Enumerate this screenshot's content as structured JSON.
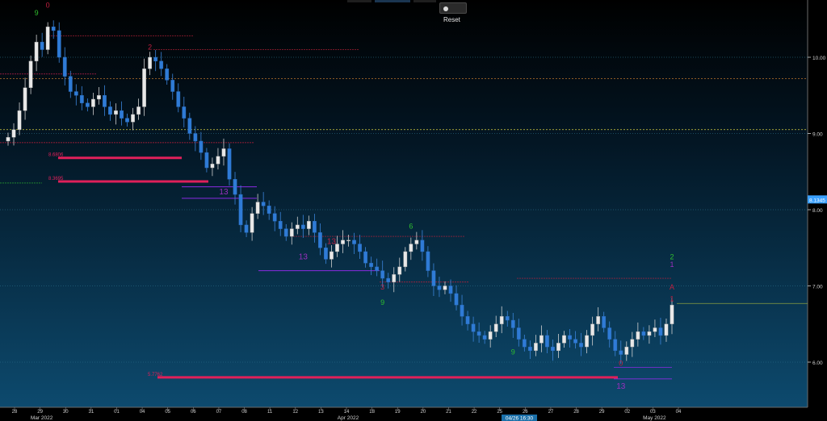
{
  "toolbar": {
    "reset_label": "Reset"
  },
  "colors": {
    "bg_top": "#000000",
    "bg_bottom": "#0d4a6e",
    "up_candle": "#e8e8e8",
    "down_candle": "#2f7bd6",
    "setup_buy": "#9b2fbf",
    "setup_sell": "#2fbf2f",
    "resistance": "#e0205a",
    "support_line": "#e0205a",
    "tdst_line": "#8a2be2",
    "current_price": "#3aa0ff"
  },
  "chart_data": {
    "type": "candlestick",
    "y_ticks": [
      "10.00",
      "9.00",
      "8.00",
      "7.00",
      "6.00"
    ],
    "current_price_label": "8.1345",
    "ylim": [
      5.05,
      10.6
    ],
    "x_ticks": [
      "28",
      "29",
      "30",
      "31",
      "01",
      "04",
      "05",
      "06",
      "07",
      "08",
      "11",
      "12",
      "13",
      "14",
      "18",
      "19",
      "20",
      "21",
      "22",
      "25",
      "26",
      "27",
      "28",
      "29",
      "02",
      "03",
      "04"
    ],
    "month_labels": [
      {
        "label": "Mar 2022",
        "index": 1
      },
      {
        "label": "Apr 2022",
        "index": 13
      },
      {
        "label": "May 2022",
        "index": 25
      }
    ],
    "cursor_label": "04/26 16:30",
    "horizontal_levels": [
      {
        "label": "8.6806",
        "value": 8.68
      },
      {
        "label": "8.3695",
        "value": 8.37
      },
      {
        "label": "5.7762",
        "value": 5.8
      }
    ],
    "closes": [
      8.95,
      9.05,
      9.3,
      9.6,
      9.95,
      10.2,
      10.1,
      10.4,
      10.35,
      10.0,
      9.75,
      9.55,
      9.5,
      9.4,
      9.35,
      9.45,
      9.5,
      9.35,
      9.25,
      9.3,
      9.2,
      9.15,
      9.25,
      9.35,
      9.85,
      10.0,
      9.95,
      9.85,
      9.7,
      9.55,
      9.35,
      9.2,
      9.0,
      8.9,
      8.75,
      8.55,
      8.6,
      8.7,
      8.8,
      8.4,
      8.2,
      7.8,
      7.7,
      7.95,
      8.1,
      8.05,
      7.95,
      7.85,
      7.75,
      7.65,
      7.75,
      7.8,
      7.75,
      7.85,
      7.7,
      7.5,
      7.35,
      7.45,
      7.55,
      7.6,
      7.6,
      7.55,
      7.45,
      7.3,
      7.25,
      7.2,
      7.1,
      7.05,
      7.15,
      7.25,
      7.45,
      7.55,
      7.6,
      7.45,
      7.2,
      7.0,
      6.95,
      7.0,
      6.9,
      6.75,
      6.6,
      6.5,
      6.4,
      6.35,
      6.3,
      6.4,
      6.5,
      6.6,
      6.55,
      6.45,
      6.3,
      6.2,
      6.15,
      6.25,
      6.35,
      6.2,
      6.15,
      6.25,
      6.35,
      6.3,
      6.25,
      6.2,
      6.35,
      6.5,
      6.6,
      6.45,
      6.3,
      6.15,
      6.1,
      6.2,
      6.3,
      6.4,
      6.35,
      6.4,
      6.45,
      6.35,
      6.5,
      6.75
    ],
    "setup_annotations": [
      {
        "text": "9",
        "i": 5,
        "v": 10.55,
        "color": "sell"
      },
      {
        "text": "0",
        "i": 7,
        "v": 10.65,
        "color": "resist"
      },
      {
        "text": "2",
        "i": 25,
        "v": 10.1,
        "color": "resist"
      },
      {
        "text": "13",
        "i": 38,
        "v": 8.2,
        "color": "buy"
      },
      {
        "text": "13",
        "i": 52,
        "v": 7.35,
        "color": "buy"
      },
      {
        "text": "13",
        "i": 57,
        "v": 7.55,
        "color": "resist"
      },
      {
        "text": "6",
        "i": 71,
        "v": 7.75,
        "color": "sell"
      },
      {
        "text": "9",
        "i": 66,
        "v": 6.75,
        "color": "sell"
      },
      {
        "text": "3",
        "i": 66,
        "v": 6.95,
        "color": "resist"
      },
      {
        "text": "9",
        "i": 89,
        "v": 6.1,
        "color": "sell"
      },
      {
        "text": "13",
        "i": 108,
        "v": 5.65,
        "color": "buy"
      },
      {
        "text": "0",
        "i": 108,
        "v": 5.95,
        "color": "resist"
      },
      {
        "text": "2",
        "i": 117,
        "v": 7.35,
        "color": "sell"
      },
      {
        "text": "1",
        "i": 117,
        "v": 7.25,
        "color": "buy"
      },
      {
        "text": "A",
        "i": 117,
        "v": 6.95,
        "color": "resist"
      },
      {
        "text": "1",
        "i": 117,
        "v": 6.8,
        "color": "resist"
      }
    ]
  }
}
